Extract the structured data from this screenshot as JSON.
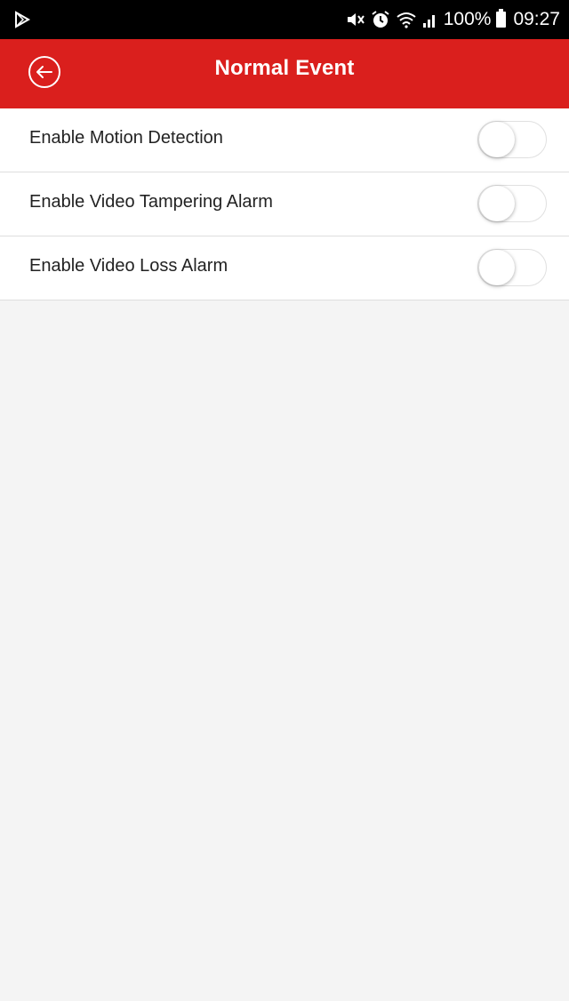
{
  "status_bar": {
    "app_icon": "play-store-icon",
    "icons": [
      "mute-icon",
      "alarm-icon",
      "wifi-icon",
      "signal-icon",
      "battery-icon"
    ],
    "battery": "100%",
    "time": "09:27"
  },
  "header": {
    "title": "Normal Event",
    "back_icon": "back-arrow-icon",
    "color": "#da1f1d"
  },
  "settings": [
    {
      "label": "Enable Motion Detection",
      "enabled": false
    },
    {
      "label": "Enable Video Tampering Alarm",
      "enabled": false
    },
    {
      "label": "Enable Video Loss Alarm",
      "enabled": false
    }
  ]
}
